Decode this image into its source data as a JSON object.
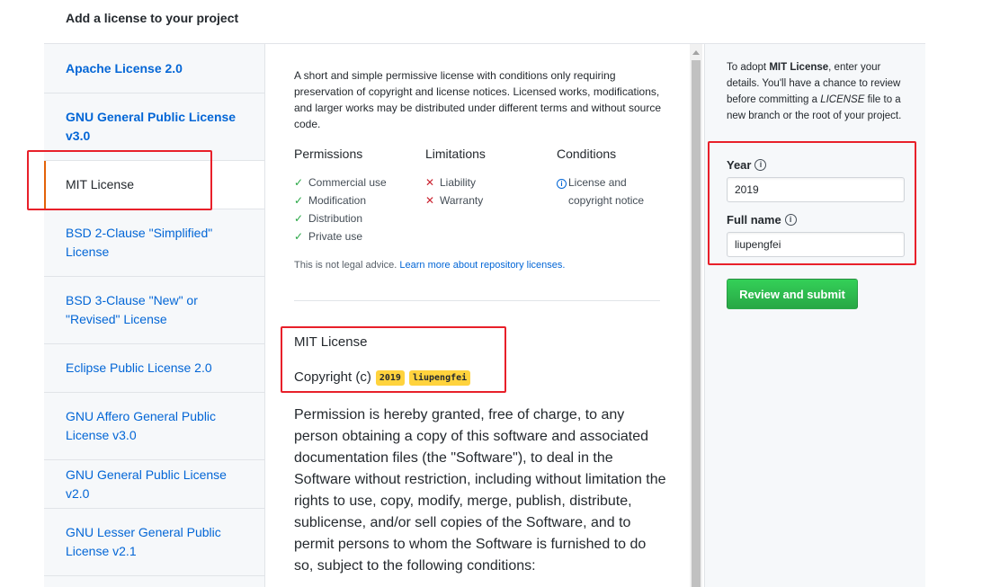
{
  "page": {
    "title": "Add a license to your project"
  },
  "sidebar": {
    "items": [
      {
        "label": "Apache License 2.0",
        "bold": true
      },
      {
        "label": "GNU General Public License v3.0",
        "bold": true
      },
      {
        "label": "MIT License",
        "selected": true
      },
      {
        "label": "BSD 2-Clause \"Simplified\" License"
      },
      {
        "label": "BSD 3-Clause \"New\" or \"Revised\" License"
      },
      {
        "label": "Eclipse Public License 2.0"
      },
      {
        "label": "GNU Affero General Public License v3.0"
      },
      {
        "label": "GNU General Public License v2.0"
      },
      {
        "label": "GNU Lesser General Public License v2.1"
      }
    ]
  },
  "main": {
    "description": "A short and simple permissive license with conditions only requiring preservation of copyright and license notices. Licensed works, modifications, and larger works may be distributed under different terms and without source code.",
    "permissions": {
      "heading": "Permissions",
      "items": [
        "Commercial use",
        "Modification",
        "Distribution",
        "Private use"
      ]
    },
    "limitations": {
      "heading": "Limitations",
      "items": [
        "Liability",
        "Warranty"
      ]
    },
    "conditions": {
      "heading": "Conditions",
      "items": [
        "License and copyright notice"
      ]
    },
    "legal_text": "This is not legal advice.",
    "legal_link": "Learn more about repository licenses.",
    "license_title": "MIT License",
    "copyright_prefix": "Copyright (c)",
    "year_tag": "2019",
    "name_tag": "liupengfei",
    "license_body": "Permission is hereby granted, free of charge, to any person obtaining a copy of this software and associated documentation files (the \"Software\"), to deal in the Software without restriction, including without limitation the rights to use, copy, modify, merge, publish, distribute, sublicense, and/or sell copies of the Software, and to permit persons to whom the Software is furnished to do so, subject to the following conditions:"
  },
  "right": {
    "intro_a": "To adopt ",
    "intro_b": "MIT License",
    "intro_c": ", enter your details. You'll have a chance to review before committing a ",
    "intro_d": "LICENSE",
    "intro_e": " file to a new branch or the root of your project.",
    "year_label": "Year",
    "year_value": "2019",
    "name_label": "Full name",
    "name_value": "liupengfei",
    "submit_label": "Review and submit"
  },
  "colors": {
    "link": "#0366d6",
    "check": "#28a745",
    "cross": "#cb2431",
    "highlight": "#e8202a",
    "tag": "#ffd33d",
    "selected_bar": "#e36209"
  }
}
